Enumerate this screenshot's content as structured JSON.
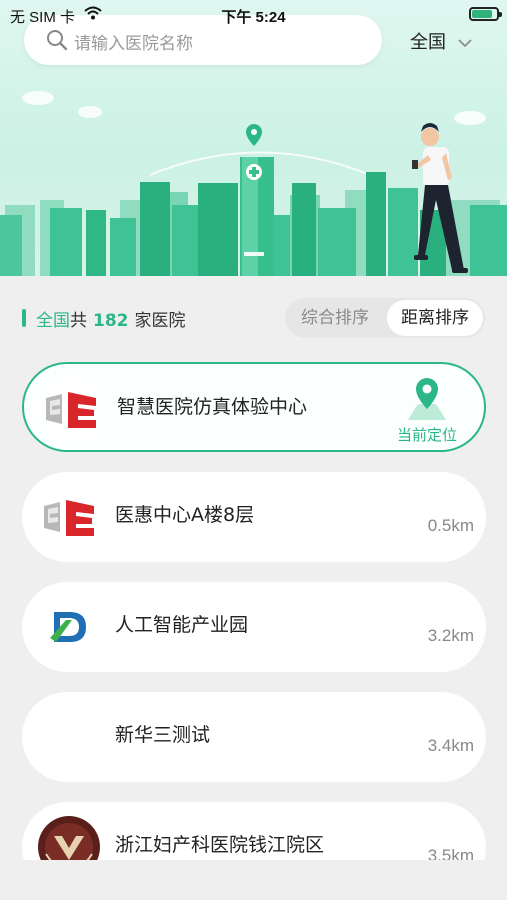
{
  "status_bar": {
    "carrier": "无 SIM 卡",
    "time": "下午 5:24"
  },
  "search": {
    "placeholder": "请输入医院名称"
  },
  "region": {
    "label": "全国"
  },
  "summary": {
    "scope": "全国",
    "prefix_word": "共",
    "count": "182",
    "suffix": "家医院"
  },
  "sort": {
    "options": [
      "综合排序",
      "距离排序"
    ],
    "selected": "距离排序"
  },
  "hospitals": [
    {
      "name": "智慧医院仿真体验中心",
      "distance": "",
      "action": "当前定位",
      "logo": "ee-logo"
    },
    {
      "name": "医惠中心A楼8层",
      "distance": "0.5km",
      "logo": "ee-logo"
    },
    {
      "name": "人工智能产业园",
      "distance": "3.2km",
      "logo": "d-logo"
    },
    {
      "name": "新华三测试",
      "distance": "3.4km",
      "logo": "none"
    },
    {
      "name": "浙江妇产科医院钱江院区",
      "distance": "3.5km",
      "logo": "emblem-logo"
    }
  ],
  "colors": {
    "accent": "#2cb789",
    "background": "#efefef"
  }
}
